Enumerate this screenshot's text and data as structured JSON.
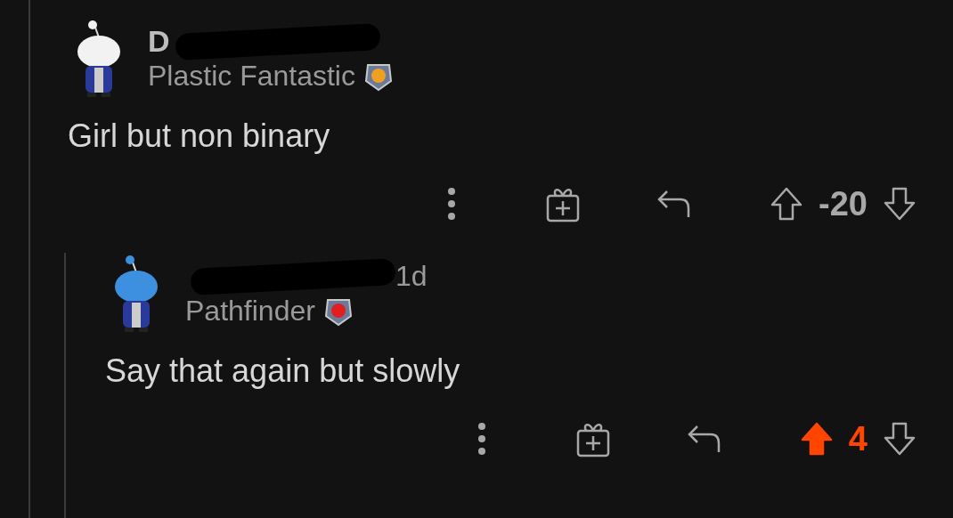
{
  "comments": [
    {
      "author": "D",
      "author_redacted": true,
      "flair": "Plastic Fantastic",
      "body": "Girl but non binary",
      "score": "-20",
      "upvoted": false,
      "children": [
        {
          "author_redacted": true,
          "age": "1d",
          "flair": "Pathfinder",
          "body": "Say that again but slowly",
          "score": "4",
          "upvoted": true
        }
      ]
    }
  ]
}
